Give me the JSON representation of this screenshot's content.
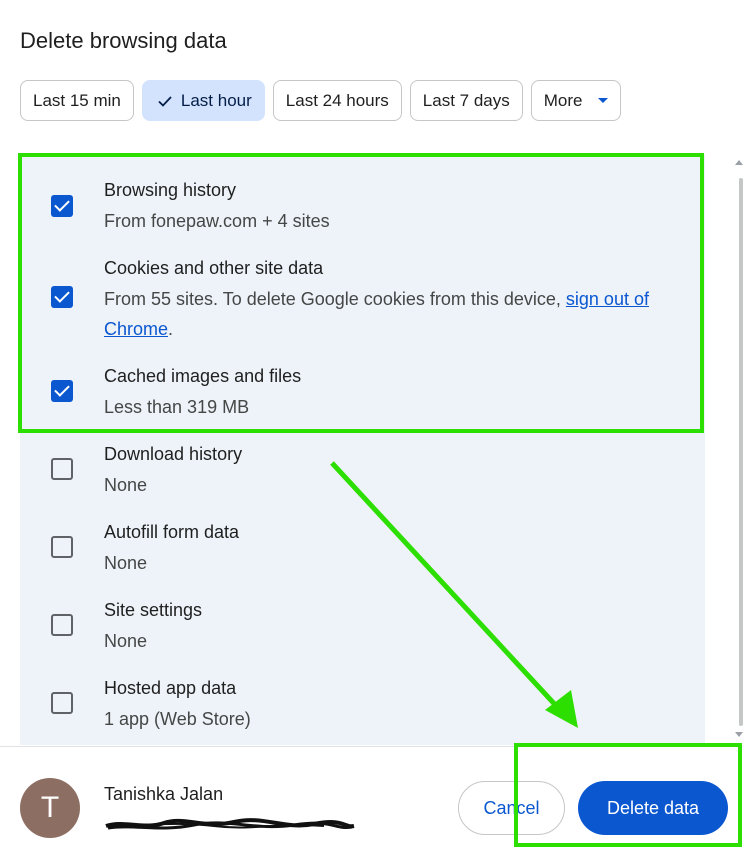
{
  "dialog": {
    "title": "Delete browsing data"
  },
  "time_range": {
    "chips": [
      {
        "label": "Last 15 min",
        "selected": false
      },
      {
        "label": "Last hour",
        "selected": true
      },
      {
        "label": "Last 24 hours",
        "selected": false
      },
      {
        "label": "Last 7 days",
        "selected": false
      },
      {
        "label": "More",
        "selected": false,
        "dropdown": true
      }
    ]
  },
  "data_types": [
    {
      "title": "Browsing history",
      "subtitle": "From fonepaw.com + 4 sites",
      "checked": true
    },
    {
      "title": "Cookies and other site data",
      "subtitle": "From 55 sites. To delete Google cookies from this device,",
      "link": "sign out of Chrome",
      "subtitle_end": ".",
      "checked": true
    },
    {
      "title": "Cached images and files",
      "subtitle": "Less than 319 MB",
      "checked": true
    },
    {
      "title": "Download history",
      "subtitle": "None",
      "checked": false
    },
    {
      "title": "Autofill form data",
      "subtitle": "None",
      "checked": false
    },
    {
      "title": "Site settings",
      "subtitle": "None",
      "checked": false
    },
    {
      "title": "Hosted app data",
      "subtitle": "1 app (Web Store)",
      "checked": false
    }
  ],
  "account": {
    "initial": "T",
    "name": "Tanishka Jalan"
  },
  "buttons": {
    "cancel": "Cancel",
    "delete": "Delete data"
  },
  "colors": {
    "accent": "#0b57d0",
    "highlight": "#2ddf00",
    "list_bg": "#eef3f9",
    "chip_selected": "#d3e3fd",
    "avatar": "#8d6e63"
  },
  "icons": {
    "selected_chip": "check-icon",
    "more_chip": "caret-down-icon"
  }
}
